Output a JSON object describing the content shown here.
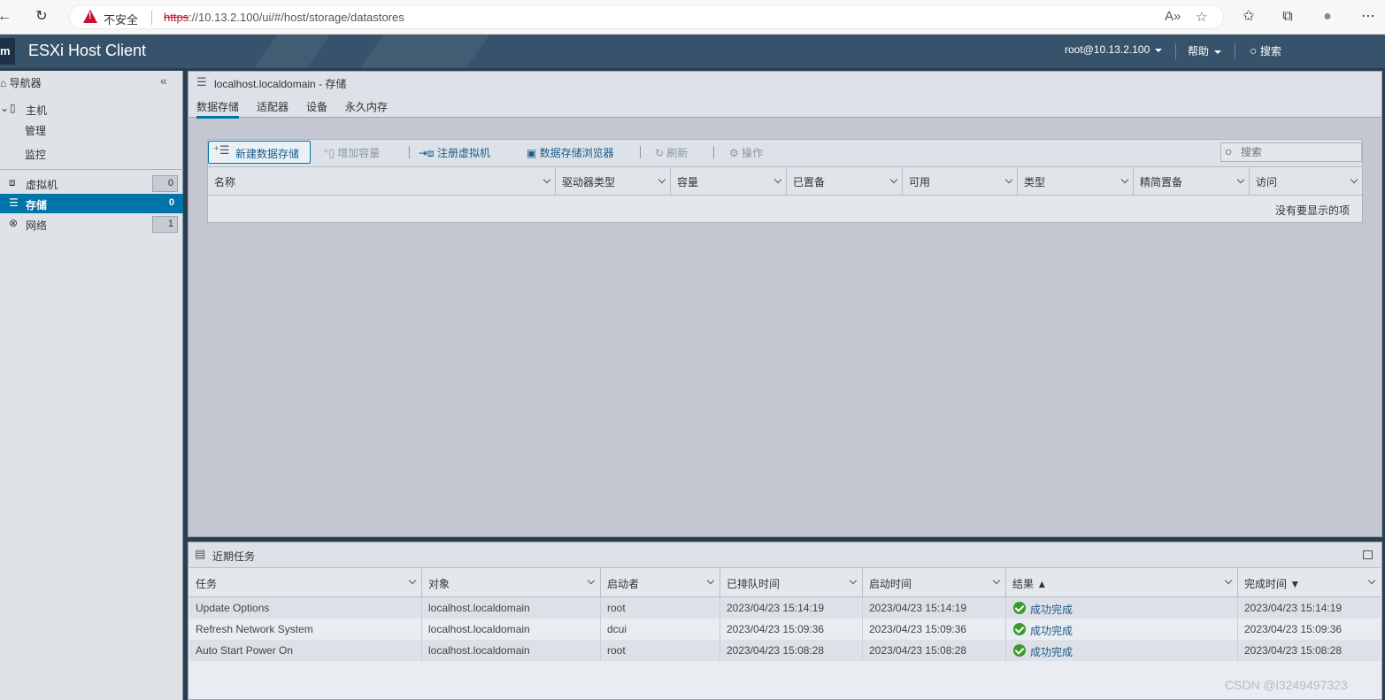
{
  "browser": {
    "insecure_label": "不安全",
    "url_scheme": "https",
    "url_rest": "://10.13.2.100/ui/#/host/storage/datastores"
  },
  "header": {
    "logo": "m",
    "app_title": "ESXi Host Client",
    "user": "root@10.13.2.100",
    "help": "帮助",
    "search": "搜索"
  },
  "navigator": {
    "title": "导航器",
    "host_label": "主机",
    "host_children": [
      "管理",
      "监控"
    ],
    "items": [
      {
        "label": "虚拟机",
        "count": "0"
      },
      {
        "label": "存储",
        "count": "0",
        "active": true
      },
      {
        "label": "网络",
        "count": "1"
      }
    ]
  },
  "main": {
    "title": "localhost.localdomain - 存储",
    "tabs": [
      "数据存储",
      "适配器",
      "设备",
      "永久内存"
    ],
    "toolbar": {
      "new_datastore": "新建数据存储",
      "increase_capacity": "增加容量",
      "register_vm": "注册虚拟机",
      "datastore_browser": "数据存储浏览器",
      "refresh": "刷新",
      "actions": "操作",
      "search_placeholder": "搜索"
    },
    "columns": [
      "名称",
      "驱动器类型",
      "容量",
      "已置备",
      "可用",
      "类型",
      "精简置备",
      "访问"
    ],
    "empty_text": "没有要显示的项"
  },
  "tasks": {
    "title": "近期任务",
    "columns": [
      "任务",
      "对象",
      "启动者",
      "已排队时间",
      "启动时间",
      "结果 ▲",
      "完成时间 ▼"
    ],
    "rows": [
      {
        "task": "Update Options",
        "target": "localhost.localdomain",
        "initiator": "root",
        "queued": "2023/04/23 15:14:19",
        "started": "2023/04/23 15:14:19",
        "result": "成功完成",
        "completed": "2023/04/23 15:14:19"
      },
      {
        "task": "Refresh Network System",
        "target": "localhost.localdomain",
        "initiator": "dcui",
        "queued": "2023/04/23 15:09:36",
        "started": "2023/04/23 15:09:36",
        "result": "成功完成",
        "completed": "2023/04/23 15:09:36"
      },
      {
        "task": "Auto Start Power On",
        "target": "localhost.localdomain",
        "initiator": "root",
        "queued": "2023/04/23 15:08:28",
        "started": "2023/04/23 15:08:28",
        "result": "成功完成",
        "completed": "2023/04/23 15:08:28"
      }
    ]
  },
  "watermark": "CSDN @l3249497323"
}
